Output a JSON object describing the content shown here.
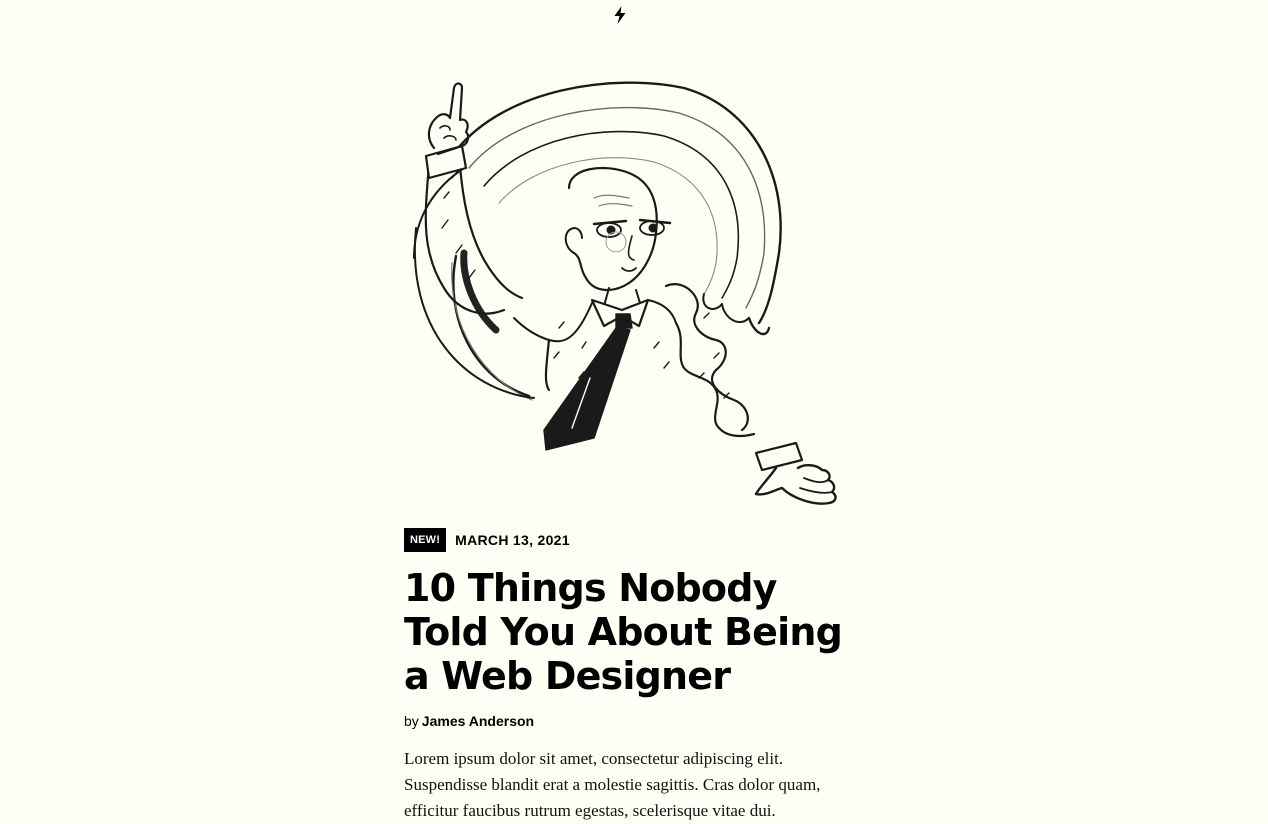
{
  "header": {
    "logo_icon": "lightning-bolt-icon"
  },
  "hero": {
    "illustration": "man-pointing-up-in-circle-illustration"
  },
  "post": {
    "badge": "NEW!",
    "date": "MARCH 13, 2021",
    "title": "10 Things Nobody Told You About Being a Web Designer",
    "by_label": "by",
    "author": "James Anderson",
    "excerpt": "Lorem ipsum dolor sit amet, consectetur adipiscing elit. Suspendisse blandit erat a molestie sagittis. Cras dolor quam, efficitur faucibus rutrum egestas, scelerisque vitae dui."
  },
  "colors": {
    "background": "#fffff5",
    "text": "#000000",
    "badge_bg": "#000000",
    "badge_text": "#ffffff"
  }
}
